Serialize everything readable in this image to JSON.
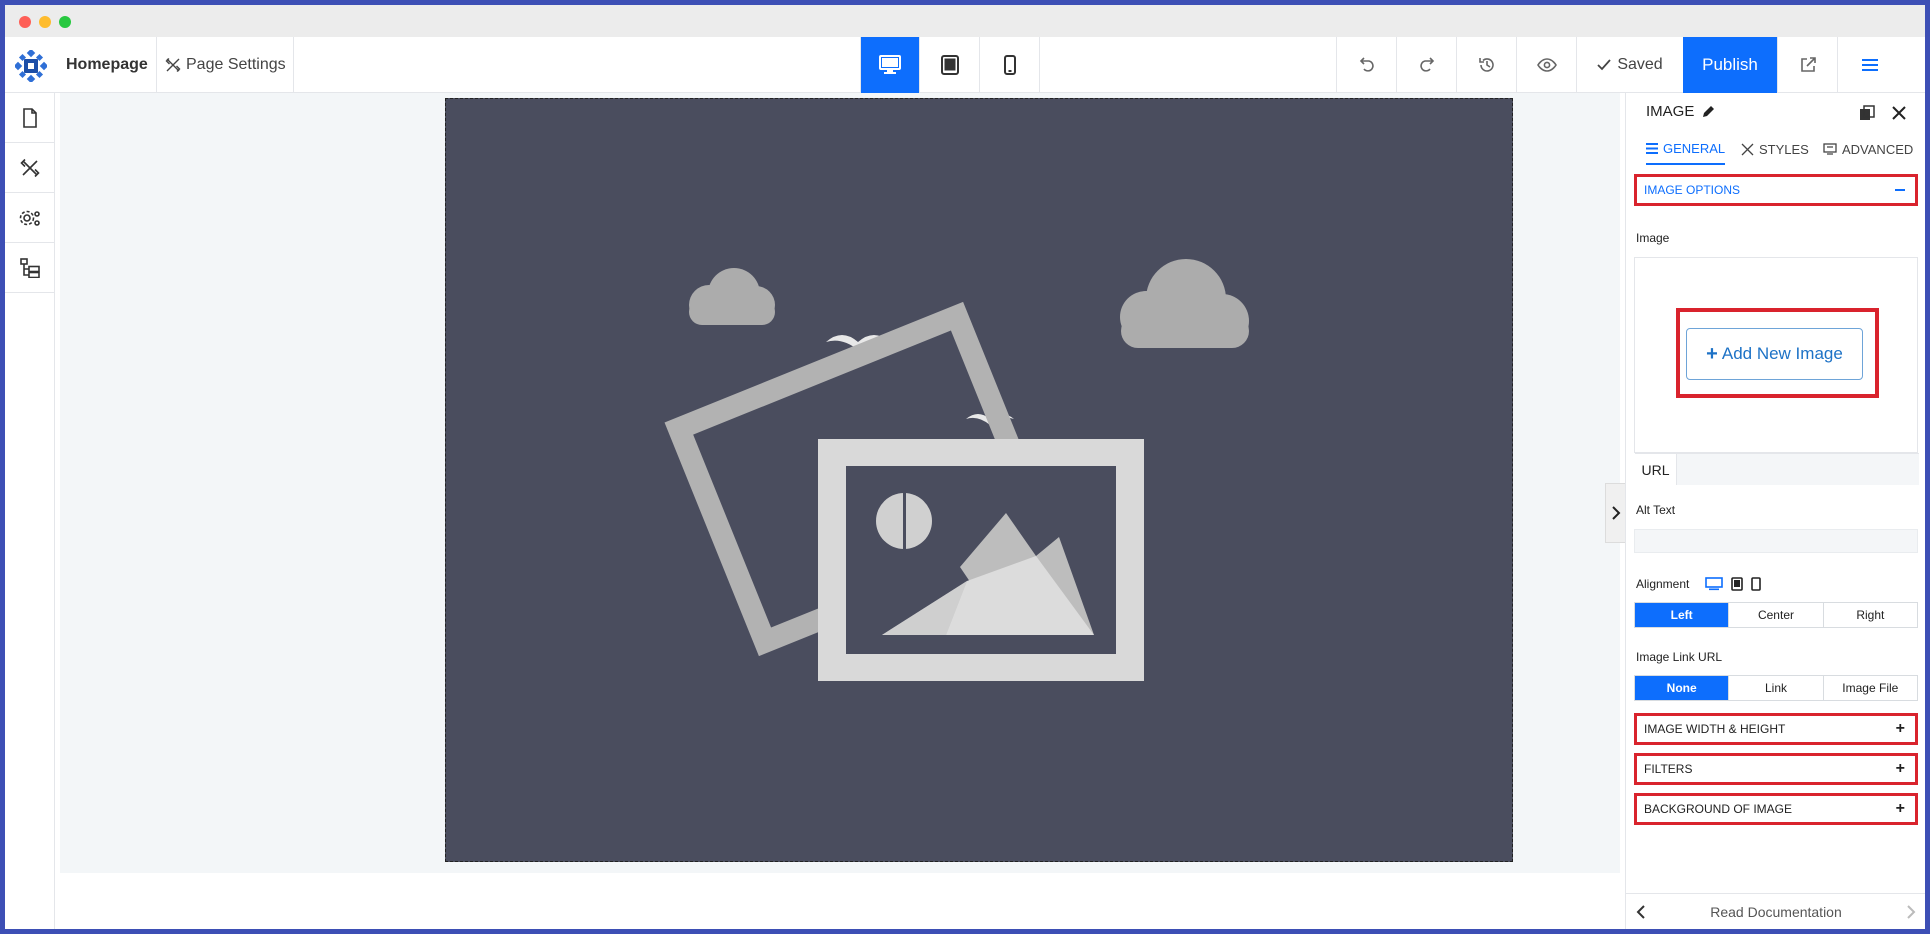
{
  "topbar": {
    "page_name": "Homepage",
    "page_settings_label": "Page Settings",
    "saved_label": "Saved",
    "publish_label": "Publish"
  },
  "panel": {
    "title": "IMAGE",
    "tabs": [
      "GENERAL",
      "STYLES",
      "ADVANCED"
    ],
    "active_tab": "GENERAL",
    "sections": {
      "image_options": "IMAGE OPTIONS",
      "width_height": "IMAGE WIDTH & HEIGHT",
      "filters": "FILTERS",
      "background": "BACKGROUND OF IMAGE"
    },
    "image_label": "Image",
    "add_new_image": "Add New Image",
    "url_label": "URL",
    "url_value": "",
    "alt_text_label": "Alt Text",
    "alt_text_value": "",
    "alignment_label": "Alignment",
    "alignment_options": [
      "Left",
      "Center",
      "Right"
    ],
    "alignment_selected": "Left",
    "link_label": "Image Link URL",
    "link_options": [
      "None",
      "Link",
      "Image File"
    ],
    "link_selected": "None",
    "footer_label": "Read Documentation"
  },
  "colors": {
    "accent": "#0d6efd",
    "highlight": "#d9232d",
    "image_bg": "#4a4d5e"
  }
}
